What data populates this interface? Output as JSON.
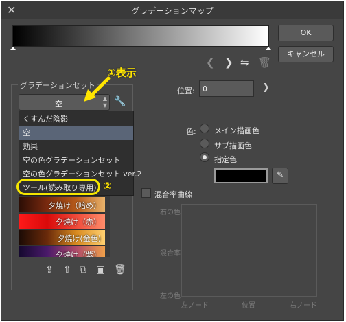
{
  "window": {
    "title": "グラデーションマップ",
    "close_icon": "close-icon"
  },
  "buttons": {
    "ok": "OK",
    "cancel": "キャンセル"
  },
  "gradient_set": {
    "label": "グラデーションセット",
    "selected": "空",
    "dropdown_items": [
      "くすんだ陰影",
      "空",
      "効果",
      "空の色グラデーションセット",
      "空の色グラデーションセット ver.2",
      "ツール(読み取り専用)"
    ],
    "presets": [
      "夕焼け（暗め）",
      "夕焼け（赤）",
      "夕焼け(金色)",
      "夕焼け（紫）"
    ]
  },
  "position": {
    "label": "位置:",
    "value": "0"
  },
  "color": {
    "label": "色:",
    "options": [
      "メイン描画色",
      "サブ描画色",
      "指定色"
    ],
    "selected_index": 2,
    "swatch": "#000000"
  },
  "blend_curve": {
    "checkbox_label": "混合率曲線",
    "y_top": "右の色",
    "y_mid": "混合率",
    "y_bottom": "左の色",
    "x_left": "左ノード",
    "x_mid": "位置",
    "x_right": "右ノード"
  },
  "annotations": {
    "step1": "①表示",
    "step2": "②"
  },
  "colors": {
    "accent_highlight": "#f5e600",
    "selected_row": "#5a6577",
    "window_bg": "#454545"
  }
}
